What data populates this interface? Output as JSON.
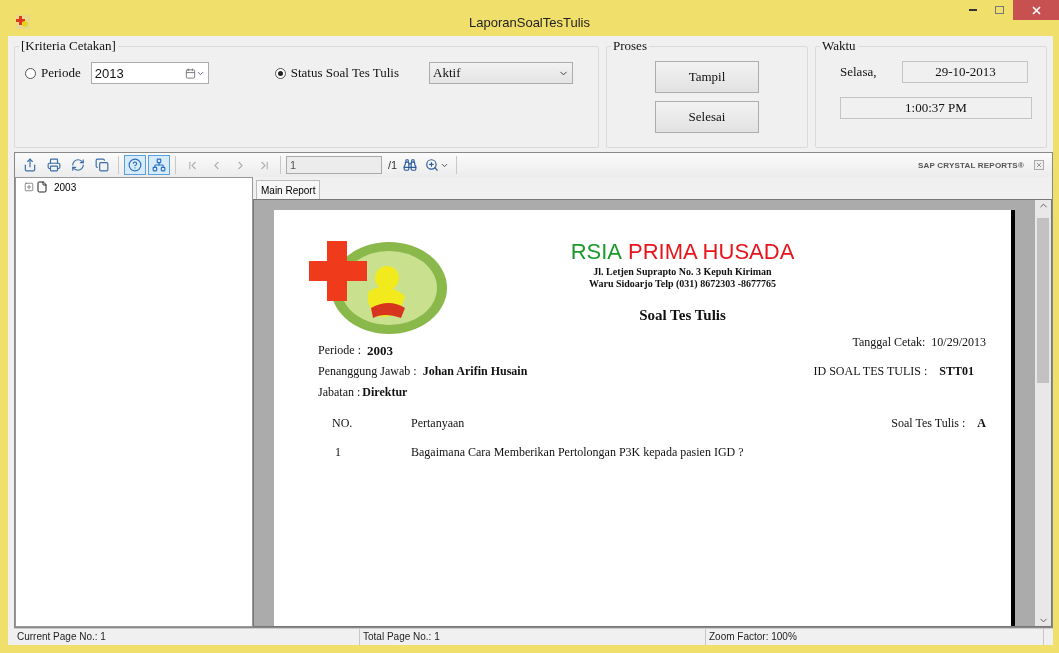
{
  "window": {
    "title": "LaporanSoalTesTulis"
  },
  "criteria": {
    "title": "[Kriteria Cetakan]",
    "options": [
      {
        "kind": "date",
        "label": "Periode",
        "selected": false,
        "value": "2013"
      },
      {
        "kind": "select",
        "label": "Status Soal Tes Tulis",
        "selected": true,
        "value": "Aktif"
      }
    ]
  },
  "process": {
    "title": "Proses",
    "buttons": [
      "Tampil",
      "Selesai"
    ]
  },
  "time": {
    "title": "Waktu",
    "day": "Selasa,",
    "date": "29-10-2013",
    "clock": "1:00:37 PM"
  },
  "viewer": {
    "tools": [
      {
        "kind": "export",
        "on": false
      },
      {
        "kind": "print",
        "on": false
      },
      {
        "kind": "refresh",
        "on": false
      },
      {
        "kind": "copy",
        "on": false
      },
      {
        "kind": "help",
        "on": true
      },
      {
        "kind": "tree",
        "on": true
      }
    ],
    "nav": [
      {
        "kind": "first",
        "disabled": true
      },
      {
        "kind": "prev",
        "disabled": true
      },
      {
        "kind": "next",
        "disabled": true
      },
      {
        "kind": "last",
        "disabled": true
      }
    ],
    "page": "1",
    "page_total": "/1",
    "brand": "SAP CRYSTAL REPORTS®",
    "tree": [
      {
        "label": "2003",
        "expanded": false
      }
    ],
    "tabs": [
      {
        "label": "Main Report",
        "selected": true
      }
    ]
  },
  "report": {
    "brand_left": "RSIA",
    "brand_right": "PRIMA HUSADA",
    "address": [
      "Jl. Letjen Suprapto No. 3 Kepuh Kiriman",
      "Waru Sidoarjo Telp (031) 8672303  -8677765"
    ],
    "title": "Soal Tes Tulis",
    "print_date": {
      "label": "Tanggal Cetak:",
      "value": "10/29/2013"
    },
    "periode": {
      "label": "Periode :",
      "value": "2003"
    },
    "pic": {
      "label": "Penanggung Jawab :",
      "value": "Johan Arifin Husain"
    },
    "id": {
      "label": "ID SOAL TES TULIS :",
      "value": "STT01"
    },
    "jabatan": {
      "label": "Jabatan :",
      "value": "Direktur"
    },
    "columns": [
      "NO.",
      "Pertanyaan"
    ],
    "set": {
      "label": "Soal Tes Tulis :",
      "value": "A"
    },
    "rows": [
      {
        "no": "1",
        "question": "Bagaimana Cara Memberikan Pertolongan P3K kepada pasien IGD ?"
      }
    ]
  },
  "status_bar": [
    "Current Page No.: 1",
    "Total Page No.: 1",
    "Zoom Factor: 100%"
  ]
}
